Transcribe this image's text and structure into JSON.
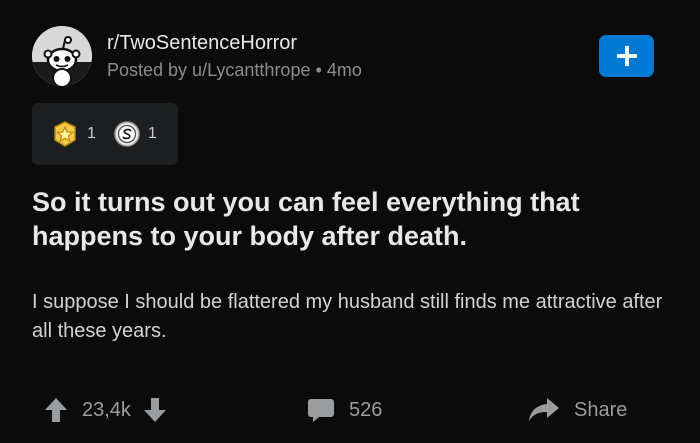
{
  "post": {
    "subreddit": "r/TwoSentenceHorror",
    "posted_by": "Posted by u/Lycantthrope",
    "separator": "•",
    "age": "4mo",
    "title": "So it turns out you can feel everything that happens to your body after death.",
    "body": "I suppose I should be flattered my husband still finds me attractive after all these years."
  },
  "awards": [
    {
      "icon": "star-award-icon",
      "count": "1"
    },
    {
      "icon": "silver-coin-award-icon",
      "count": "1"
    }
  ],
  "actions": {
    "votes": "23,4k",
    "comments": "526",
    "share_label": "Share"
  },
  "colors": {
    "background": "#0b0b0b",
    "join_button": "#0079d3",
    "award_panel": "#1d1e1f",
    "muted_text": "#8a8d90"
  }
}
